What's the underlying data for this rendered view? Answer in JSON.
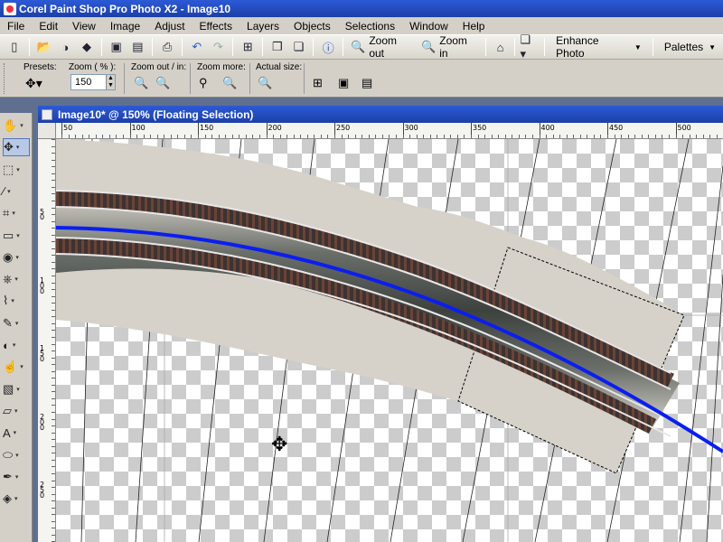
{
  "window": {
    "title": "Corel Paint Shop Pro Photo X2 - Image10"
  },
  "menu": [
    "File",
    "Edit",
    "View",
    "Image",
    "Adjust",
    "Effects",
    "Layers",
    "Objects",
    "Selections",
    "Window",
    "Help"
  ],
  "toolbar": {
    "zoom_out_label": "Zoom out",
    "zoom_in_label": "Zoom in",
    "enhance_label": "Enhance Photo",
    "palettes_label": "Palettes"
  },
  "options": {
    "presets_label": "Presets:",
    "zoom_label": "Zoom ( % ):",
    "zoom_value": "150",
    "zoom_out_in_label": "Zoom out / in:",
    "zoom_more_label": "Zoom more:",
    "actual_size_label": "Actual size:"
  },
  "image_window": {
    "title": "Image10* @ 150% (Floating Selection)"
  },
  "ruler_h_labels": [
    "50",
    "100",
    "150",
    "200",
    "250",
    "300",
    "350",
    "400",
    "450",
    "500"
  ],
  "ruler_v_labels": [
    "5\n0",
    "1\n0\n0",
    "1\n5\n0",
    "2\n0\n0",
    "2\n5\n0"
  ],
  "tools": [
    {
      "name": "pan-tool-icon",
      "glyph": "✋"
    },
    {
      "name": "move-tool-icon",
      "glyph": "✥"
    },
    {
      "name": "selection-tool-icon",
      "glyph": "⬚"
    },
    {
      "name": "dropper-tool-icon",
      "glyph": "⁄"
    },
    {
      "name": "crop-tool-icon",
      "glyph": "⌗"
    },
    {
      "name": "straighten-tool-icon",
      "glyph": "▭"
    },
    {
      "name": "red-eye-tool-icon",
      "glyph": "◉"
    },
    {
      "name": "clone-tool-icon",
      "glyph": "⎈"
    },
    {
      "name": "scratch-remover-icon",
      "glyph": "⌇"
    },
    {
      "name": "paint-brush-icon",
      "glyph": "✎"
    },
    {
      "name": "dodge-tool-icon",
      "glyph": "◐"
    },
    {
      "name": "smudge-tool-icon",
      "glyph": "☝"
    },
    {
      "name": "replacer-tool-icon",
      "glyph": "▧"
    },
    {
      "name": "eraser-tool-icon",
      "glyph": "▱"
    },
    {
      "name": "text-tool-icon",
      "glyph": "A"
    },
    {
      "name": "shape-tool-icon",
      "glyph": "⬭"
    },
    {
      "name": "pen-tool-icon",
      "glyph": "✒"
    },
    {
      "name": "flood-fill-icon",
      "glyph": "◈"
    }
  ],
  "colors": {
    "accent": "#2c5ad6",
    "curve": "#0a1ef0"
  }
}
